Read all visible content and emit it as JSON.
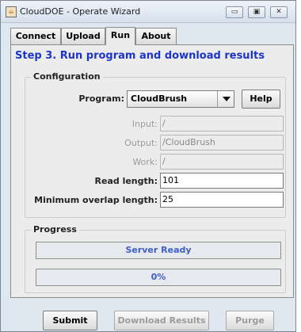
{
  "window": {
    "title": "CloudDOE - Operate Wizard",
    "icon": "java-cup-icon"
  },
  "tabs": [
    {
      "label": "Connect"
    },
    {
      "label": "Upload"
    },
    {
      "label": "Run",
      "active": true
    },
    {
      "label": "About"
    }
  ],
  "step": {
    "title": "Step 3. Run program and download results"
  },
  "configuration": {
    "group_label": "Configuration",
    "program_label": "Program:",
    "program_value": "CloudBrush",
    "help_label": "Help",
    "input_label": "Input:",
    "input_value": "/",
    "output_label": "Output:",
    "output_value": "/CloudBrush",
    "work_label": "Work:",
    "work_value": "/",
    "read_length_label": "Read length:",
    "read_length_value": "101",
    "min_overlap_label": "Minimum overlap length:",
    "min_overlap_value": "25"
  },
  "progress": {
    "group_label": "Progress",
    "status_text": "Server Ready",
    "percent_text": "0%",
    "percent_value": 0
  },
  "actions": {
    "submit_label": "Submit",
    "download_label": "Download Results",
    "purge_label": "Purge"
  },
  "colors": {
    "accent": "#1c35c8",
    "status_text": "#3e5fc4",
    "disabled_text": "#9b9b9b"
  }
}
